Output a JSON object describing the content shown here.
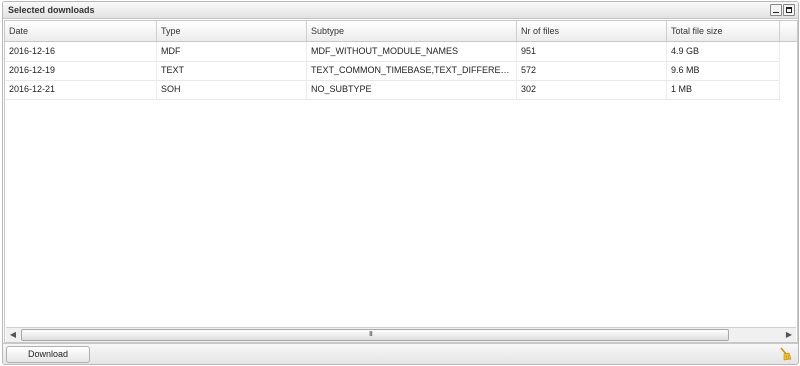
{
  "window": {
    "title": "Selected downloads"
  },
  "grid": {
    "columns": [
      "Date",
      "Type",
      "Subtype",
      "Nr of files",
      "Total file size"
    ],
    "rows": [
      [
        "2016-12-16",
        "MDF",
        "MDF_WITHOUT_MODULE_NAMES",
        "951",
        "4.9 GB"
      ],
      [
        "2016-12-19",
        "TEXT",
        "TEXT_COMMON_TIMEBASE,TEXT_DIFFERE…",
        "572",
        "9.6 MB"
      ],
      [
        "2016-12-21",
        "SOH",
        "NO_SUBTYPE",
        "302",
        "1 MB"
      ]
    ],
    "scrollbar_grip": "III"
  },
  "footer": {
    "download_label": "Download"
  },
  "icons": {
    "minimize": "minimize-icon",
    "maximize": "maximize-icon",
    "clear": "broom-icon"
  }
}
